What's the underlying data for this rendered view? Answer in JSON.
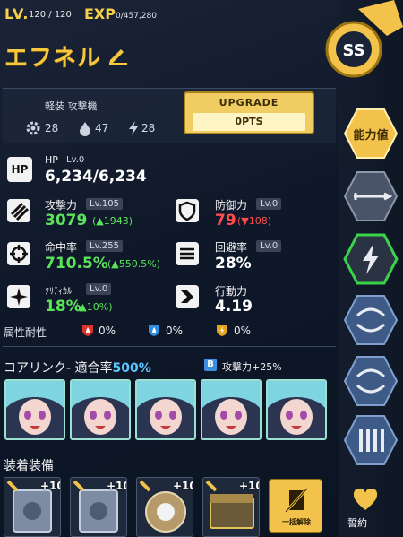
{
  "header": {
    "lv_label": "LV.",
    "level": "120 / 120",
    "exp_label": "EXP",
    "exp_value": "0/457,280",
    "name": "エフネル"
  },
  "info": {
    "class_label": "軽装 攻撃機",
    "gear_value": "28",
    "drop_value": "47",
    "bolt_value": "28",
    "upgrade_label": "UPGRADE",
    "upgrade_points": "0PTS"
  },
  "stats": {
    "hp": {
      "icon_text": "HP",
      "label": "HP",
      "lv": "Lv.0",
      "value": "6,234/6,234"
    },
    "attack": {
      "label": "攻撃力",
      "lv": "Lv.105",
      "value": "3079",
      "delta": "(▲1943)"
    },
    "defense": {
      "label": "防御力",
      "lv": "Lv.0",
      "value": "79",
      "delta": "(▼108)"
    },
    "accuracy": {
      "label": "命中率",
      "lv": "Lv.255",
      "value": "710.5%",
      "delta": "(▲550.5%)"
    },
    "evasion": {
      "label": "回避率",
      "lv": "Lv.0",
      "value": "28%"
    },
    "critical": {
      "label": "ｸﾘﾃｨｶﾙ",
      "lv": "Lv.0",
      "value": "18%",
      "delta": "(▲10%)"
    },
    "action": {
      "label": "行動力",
      "value": "4.19"
    }
  },
  "resist": {
    "label": "属性耐性",
    "fire": "0%",
    "ice": "0%",
    "thunder": "0%"
  },
  "core": {
    "title": "コアリンク- 適合率",
    "percent": "500%",
    "badge": "B",
    "bonus": "攻撃力+25%"
  },
  "equip": {
    "title": "装着装備",
    "plus": "+10",
    "bulk_label": "一括解除"
  },
  "side": {
    "stats_tab": "能力値",
    "pledge": "誓約",
    "ss_label": "SS"
  },
  "colors": {
    "gold": "#f6c83c",
    "up": "#5be35b",
    "down": "#ff4d4d",
    "accent": "#5bc8ff"
  }
}
